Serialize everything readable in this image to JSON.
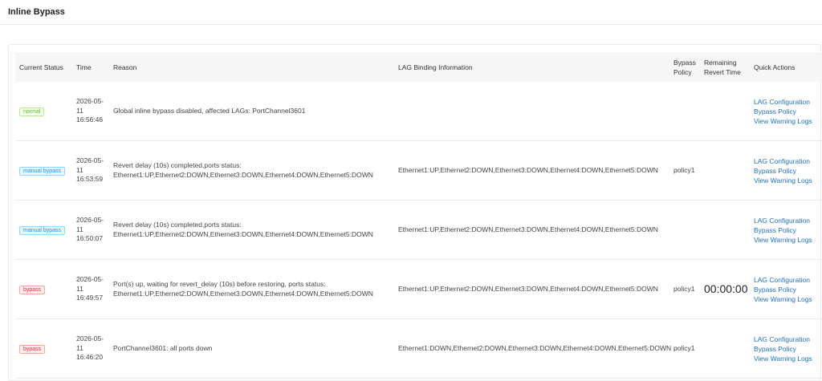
{
  "page": {
    "title": "Inline Bypass"
  },
  "table": {
    "columns": {
      "status": "Current Status",
      "time": "Time",
      "reason": "Reason",
      "lag": "LAG Binding Information",
      "policy": "Bypass Policy",
      "remaining": "Remaining Revert Time",
      "actions": "Quick Actions"
    },
    "rows": [
      {
        "status": "normal",
        "time": "2026-05-\n11\n16:56:46",
        "reason": "Global inline bypass disabled, affected LAGs: PortChannel3601",
        "lag": "",
        "policy": "",
        "remaining": "",
        "actions": [
          "LAG Configuration",
          "Bypass Policy",
          "View Warning Logs"
        ]
      },
      {
        "status": "manual bypass",
        "time": "2026-05-\n11\n16:53:59",
        "reason": "Revert delay (10s) completed,ports status: Ethernet1:UP,Ethernet2:DOWN,Ethernet3:DOWN,Ethernet4:DOWN,Ethernet5:DOWN",
        "lag": "Ethernet1:UP,Ethernet2:DOWN,Ethernet3:DOWN,Ethernet4:DOWN,Ethernet5:DOWN",
        "policy": "policy1",
        "remaining": "",
        "actions": [
          "LAG Configuration",
          "Bypass Policy",
          "View Warning Logs"
        ]
      },
      {
        "status": "manual bypass",
        "time": "2026-05-\n11\n16:50:07",
        "reason": "Revert delay (10s) completed,ports status: Ethernet1:UP,Ethernet2:DOWN,Ethernet3:DOWN,Ethernet4:DOWN,Ethernet5:DOWN",
        "lag": "Ethernet1:UP,Ethernet2:DOWN,Ethernet3:DOWN,Ethernet4:DOWN,Ethernet5:DOWN",
        "policy": "",
        "remaining": "",
        "actions": [
          "LAG Configuration",
          "Bypass Policy",
          "View Warning Logs"
        ]
      },
      {
        "status": "bypass",
        "time": "2026-05-\n11\n16:49:57",
        "reason": "Port(s) up, waiting for revert_delay (10s) before restoring, ports status: Ethernet1:UP,Ethernet2:DOWN,Ethernet3:DOWN,Ethernet4:DOWN,Ethernet5:DOWN",
        "lag": "Ethernet1:UP,Ethernet2:DOWN,Ethernet3:DOWN,Ethernet4:DOWN,Ethernet5:DOWN",
        "policy": "policy1",
        "remaining": "00:00:00",
        "actions": [
          "LAG Configuration",
          "Bypass Policy",
          "View Warning Logs"
        ]
      },
      {
        "status": "bypass",
        "time": "2026-05-\n11\n16:46:20",
        "reason": "PortChannel3601: all ports down",
        "lag": "Ethernet1:DOWN,Ethernet2:DOWN,Ethernet3:DOWN,Ethernet4:DOWN,Ethernet5:DOWN",
        "policy": "policy1",
        "remaining": "",
        "actions": [
          "LAG Configuration",
          "Bypass Policy",
          "View Warning Logs"
        ]
      }
    ]
  }
}
